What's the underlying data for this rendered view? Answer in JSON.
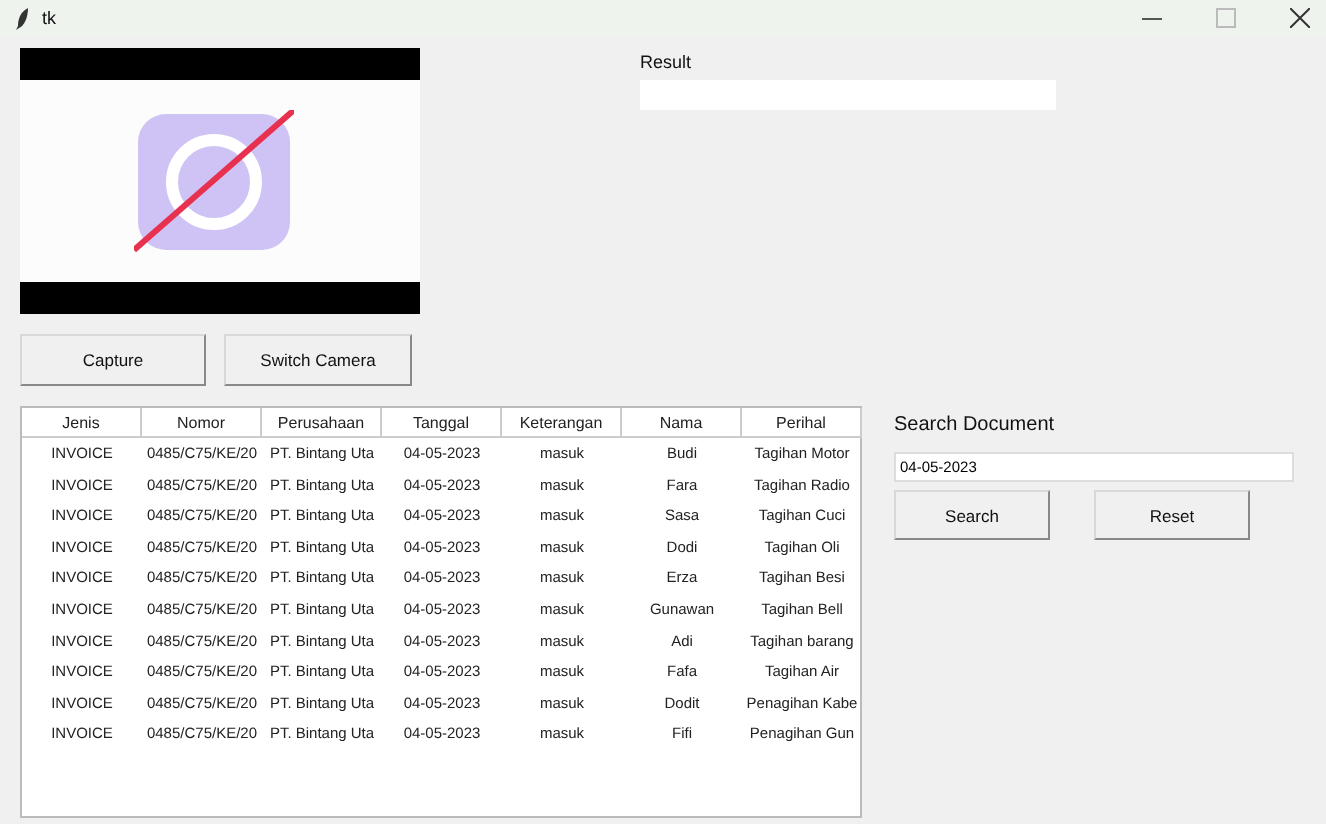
{
  "window": {
    "title": "tk"
  },
  "camera": {
    "buttons": [
      "Capture",
      "Switch Camera"
    ]
  },
  "result": {
    "label": "Result"
  },
  "table": {
    "columns": [
      "Jenis",
      "Nomor",
      "Perusahaan",
      "Tanggal",
      "Keterangan",
      "Nama",
      "Perihal"
    ],
    "rows": [
      [
        "INVOICE",
        "0485/C75/KE/20",
        "PT. Bintang Uta",
        "04-05-2023",
        "masuk",
        "Budi",
        "Tagihan Motor"
      ],
      [
        "INVOICE",
        "0485/C75/KE/20",
        "PT. Bintang Uta",
        "04-05-2023",
        "masuk",
        "Fara",
        "Tagihan Radio"
      ],
      [
        "INVOICE",
        "0485/C75/KE/20",
        "PT. Bintang Uta",
        "04-05-2023",
        "masuk",
        "Sasa",
        "Tagihan Cuci"
      ],
      [
        "INVOICE",
        "0485/C75/KE/20",
        "PT. Bintang Uta",
        "04-05-2023",
        "masuk",
        "Dodi",
        "Tagihan Oli"
      ],
      [
        "INVOICE",
        "0485/C75/KE/20",
        "PT. Bintang Uta",
        "04-05-2023",
        "masuk",
        "Erza",
        "Tagihan Besi"
      ],
      [
        "INVOICE",
        "0485/C75/KE/20",
        "PT. Bintang Uta",
        "04-05-2023",
        "masuk",
        "Gunawan",
        "Tagihan Bell"
      ],
      [
        "INVOICE",
        "0485/C75/KE/20",
        "PT. Bintang Uta",
        "04-05-2023",
        "masuk",
        "Adi",
        "Tagihan barang"
      ],
      [
        "INVOICE",
        "0485/C75/KE/20",
        "PT. Bintang Uta",
        "04-05-2023",
        "masuk",
        "Fafa",
        "Tagihan Air"
      ],
      [
        "INVOICE",
        "0485/C75/KE/20",
        "PT. Bintang Uta",
        "04-05-2023",
        "masuk",
        "Dodit",
        "Penagihan Kabe"
      ],
      [
        "INVOICE",
        "0485/C75/KE/20",
        "PT. Bintang Uta",
        "04-05-2023",
        "masuk",
        "Fifi",
        "Penagihan Gun"
      ]
    ]
  },
  "search": {
    "label": "Search Document",
    "value": "04-05-2023",
    "buttons": [
      "Search",
      "Reset"
    ]
  }
}
